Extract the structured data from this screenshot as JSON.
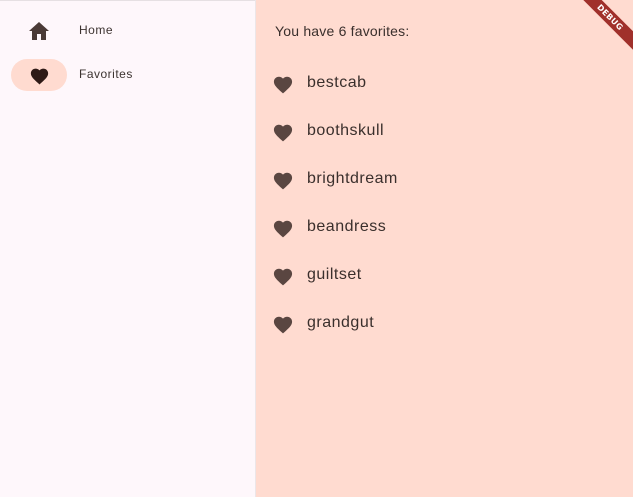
{
  "nav": {
    "items": [
      {
        "label": "Home",
        "icon": "home-icon",
        "selected": false
      },
      {
        "label": "Favorites",
        "icon": "heart-icon",
        "selected": true
      }
    ],
    "selected_color": "#ffdbd0"
  },
  "main": {
    "count_text": "You have 6 favorites:",
    "favorites": [
      {
        "word": "bestcab",
        "icon": "heart-icon"
      },
      {
        "word": "boothskull",
        "icon": "heart-icon"
      },
      {
        "word": "brightdream",
        "icon": "heart-icon"
      },
      {
        "word": "beandress",
        "icon": "heart-icon"
      },
      {
        "word": "guiltset",
        "icon": "heart-icon"
      },
      {
        "word": "grandgut",
        "icon": "heart-icon"
      }
    ],
    "background_color": "#ffdbd0",
    "icon_color": "#5a4641"
  },
  "debug_banner": {
    "label": "DEBUG",
    "color": "#a0302b"
  }
}
